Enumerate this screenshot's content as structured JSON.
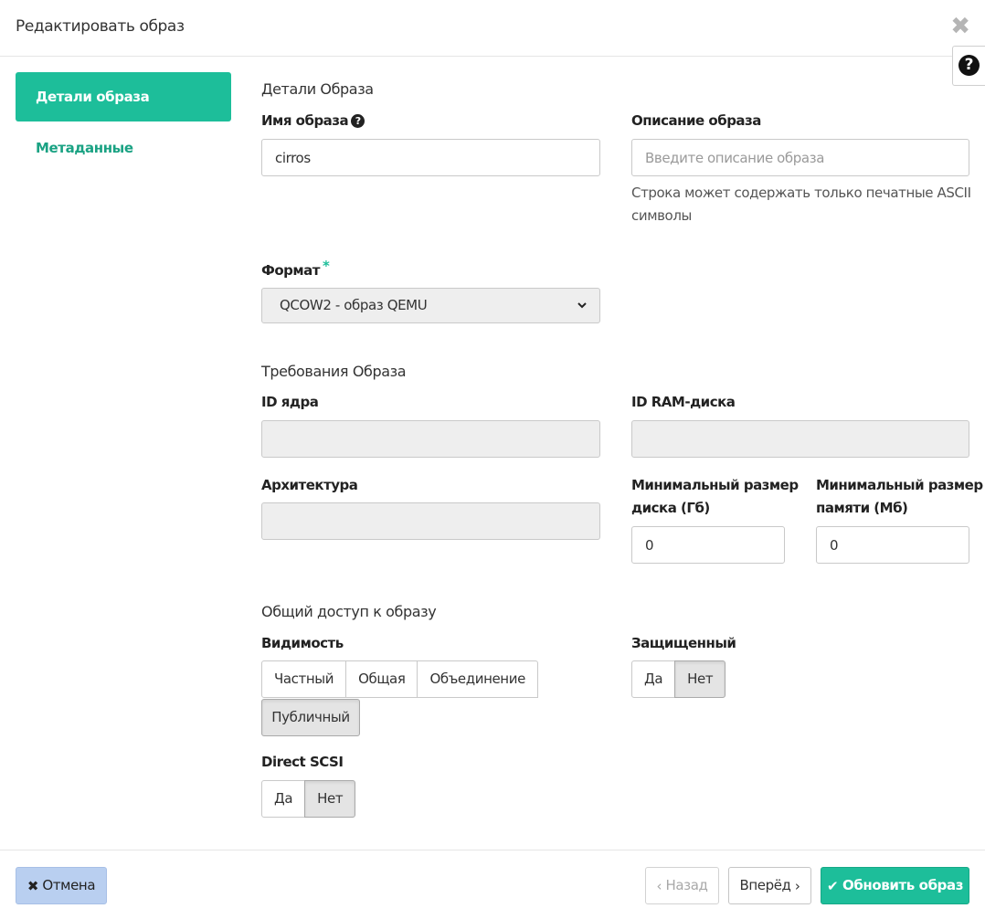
{
  "header": {
    "title": "Редактировать образ",
    "close_glyph": "✖",
    "help_glyph": "?"
  },
  "nav": {
    "items": [
      {
        "label": "Детали образа",
        "active": true
      },
      {
        "label": "Метаданные",
        "active": false
      }
    ]
  },
  "details": {
    "section_title": "Детали Образа",
    "name_label": "Имя образа",
    "name_value": "cirros",
    "description_label": "Описание образа",
    "description_placeholder": "Введите описание образа",
    "description_help_line1": "Строка может содержать только печатные ASCII",
    "description_help_line2": "символы",
    "format_label": "Формат",
    "format_required_mark": "*",
    "format_value": "QCOW2 - образ QEMU"
  },
  "requirements": {
    "section_title": "Требования Образа",
    "kernel_label": "ID ядра",
    "kernel_value": "",
    "ramdisk_label": "ID RAM-диска",
    "ramdisk_value": "",
    "arch_label": "Архитектура",
    "arch_value": "",
    "min_disk_label_line1": "Минимальный размер",
    "min_disk_label_line2": "диска (Гб)",
    "min_disk_value": "0",
    "min_ram_label_line1": "Минимальный размер",
    "min_ram_label_line2": "памяти (Мб)",
    "min_ram_value": "0"
  },
  "sharing": {
    "section_title": "Общий доступ к образу",
    "visibility_label": "Видимость",
    "visibility_options": [
      "Частный",
      "Общая",
      "Объединение",
      "Публичный"
    ],
    "visibility_selected": "Публичный",
    "protected_label": "Защищенный",
    "protected_options": [
      "Да",
      "Нет"
    ],
    "protected_selected": "Нет",
    "scsi_label": "Direct SCSI",
    "scsi_options": [
      "Да",
      "Нет"
    ],
    "scsi_selected": "Нет"
  },
  "footer": {
    "cancel_label": "Отмена",
    "back_label": "Назад",
    "next_label": "Вперёд",
    "submit_label": "Обновить образ"
  },
  "colors": {
    "accent": "#1dbe9a",
    "cancel_bg": "#b9cff0",
    "nav_link": "#1aa283"
  }
}
